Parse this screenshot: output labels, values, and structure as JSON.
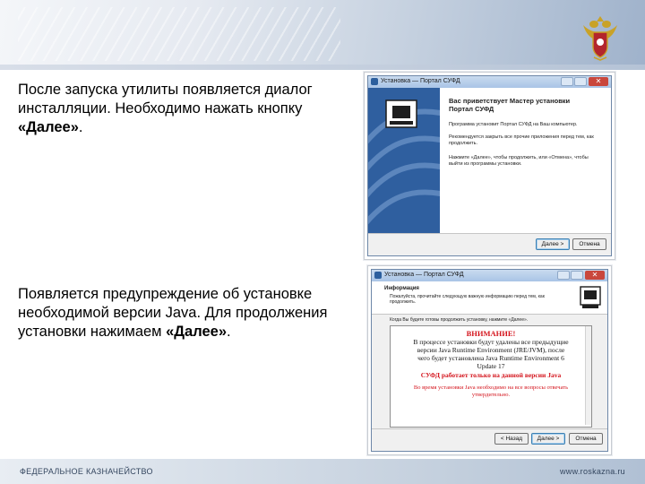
{
  "slide": {
    "paragraph1": [
      "После запуска утилиты появляется диалог инсталляции. Необходимо нажать кнопку ",
      "«Далее»",
      "."
    ],
    "paragraph2": [
      "Появляется предупреждение об установке необходимой версии Java. Для продолжения установки нажимаем ",
      "«Далее»",
      "."
    ],
    "footer_left": "ФЕДЕРАЛЬНОЕ КАЗНАЧЕЙСТВО",
    "footer_right": "www.roskazna.ru"
  },
  "window1": {
    "title": "Установка — Портал СУФД",
    "heading": "Вас приветствует Мастер установки Портал СУФД",
    "line1": "Программа установит Портал СУФД на Ваш компьютер.",
    "line2": "Рекомендуется закрыть все прочие приложения перед тем, как продолжить.",
    "line3": "Нажмите «Далее», чтобы продолжить, или «Отмена», чтобы выйти из программы установки.",
    "next_button": "Далее >",
    "cancel_button": "Отмена"
  },
  "window2": {
    "title": "Установка — Портал СУФД",
    "header_title": "Информация",
    "header_subtitle": "Пожалуйста, прочитайте следующую важную информацию перед тем, как продолжить.",
    "prompt": "Когда Вы будете готовы продолжить установку, нажмите «Далее».",
    "warning_title": "ВНИМАНИЕ!",
    "warning_body": "В процессе установки будут удалены все предыдущие версии Java Runtime Environment (JRE/JVM), после чего будет установлена Java Runtime Environment 6 Update 17",
    "warning_red": "СУФД работает только на данной версии Java",
    "warning_note": "Во время установки Java необходимо на все вопросы отвечать утвердительно.",
    "back_button": "< Назад",
    "next_button": "Далее >",
    "cancel_button": "Отмена"
  },
  "colors": {
    "warning_red": "#d4141c",
    "dialog_blue": "#2c5f9e"
  }
}
